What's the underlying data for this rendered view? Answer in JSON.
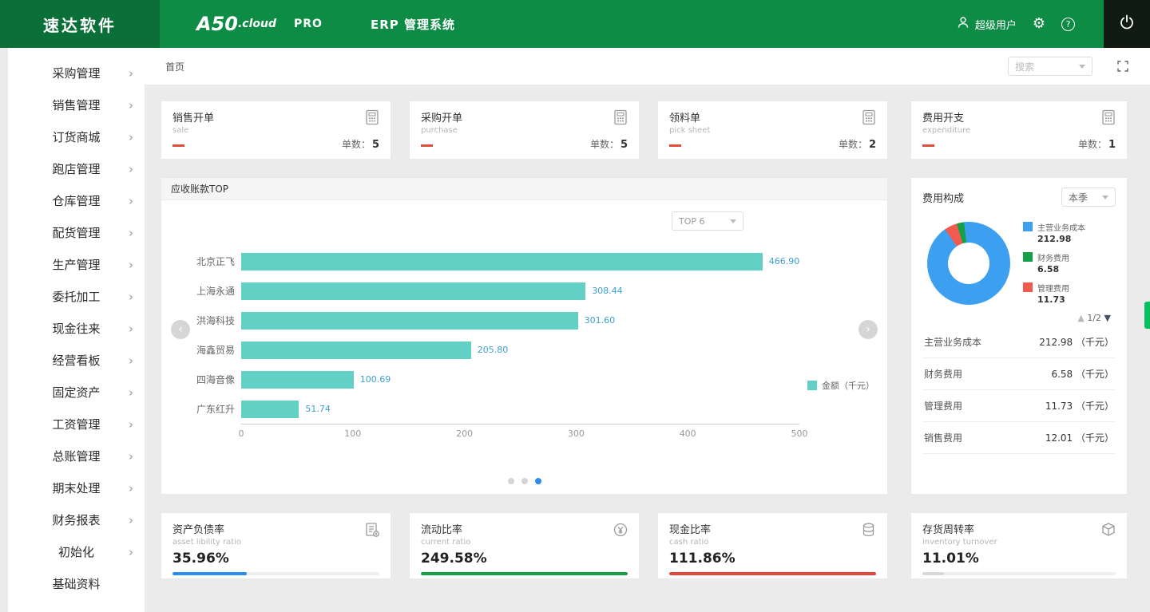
{
  "header": {
    "logo": "速达软件",
    "brand": "A50",
    "brand_suffix": ".cloud",
    "brand_pro": "PRO",
    "app_title": "ERP 管理系统",
    "user": "超级用户"
  },
  "icons": {
    "user": "user-icon",
    "settings": "gear-icon",
    "help": "help-icon",
    "power": "power-icon",
    "fullscreen": "fullscreen-icon",
    "calculator": "calculator-icon",
    "chevron": "chevron-right-icon"
  },
  "topbar": {
    "breadcrumb": "首页",
    "search_placeholder": "搜索"
  },
  "sidebar": {
    "items": [
      {
        "label": "采购管理",
        "chevron": true
      },
      {
        "label": "销售管理",
        "chevron": true
      },
      {
        "label": "订货商城",
        "chevron": true
      },
      {
        "label": "跑店管理",
        "chevron": true
      },
      {
        "label": "仓库管理",
        "chevron": true
      },
      {
        "label": "配货管理",
        "chevron": true
      },
      {
        "label": "生产管理",
        "chevron": true
      },
      {
        "label": "委托加工",
        "chevron": true
      },
      {
        "label": "现金往来",
        "chevron": true
      },
      {
        "label": "经营看板",
        "chevron": true
      },
      {
        "label": "固定资产",
        "chevron": true
      },
      {
        "label": "工资管理",
        "chevron": true
      },
      {
        "label": "总账管理",
        "chevron": true
      },
      {
        "label": "期末处理",
        "chevron": true
      },
      {
        "label": "财务报表",
        "chevron": true
      },
      {
        "label": "初始化",
        "chevron": true
      },
      {
        "label": "基础资料",
        "chevron": false
      }
    ]
  },
  "stat_cards": [
    {
      "title": "销售开单",
      "subtitle": "sale",
      "count_label": "单数：",
      "count": "5"
    },
    {
      "title": "采购开单",
      "subtitle": "purchase",
      "count_label": "单数：",
      "count": "5"
    },
    {
      "title": "领料单",
      "subtitle": "pick sheet",
      "count_label": "单数：",
      "count": "2"
    },
    {
      "title": "费用开支",
      "subtitle": "expenditure",
      "count_label": "单数：",
      "count": "1"
    }
  ],
  "chart_data": [
    {
      "type": "bar",
      "title": "应收账款TOP",
      "orientation": "horizontal",
      "top_filter": "TOP 6",
      "categories": [
        "北京正飞",
        "上海永通",
        "洪海科技",
        "海鑫贸易",
        "四海音像",
        "广东红升"
      ],
      "values": [
        466.9,
        308.44,
        301.6,
        205.8,
        100.69,
        51.74
      ],
      "xlim": [
        0,
        500
      ],
      "x_ticks": [
        "0",
        "100",
        "200",
        "300",
        "400",
        "500"
      ],
      "legend": "金额（千元）",
      "bar_color": "#62d0c5",
      "pagination": {
        "dots": 3,
        "active": 2
      }
    },
    {
      "type": "pie",
      "title": "费用构成",
      "period": "本季",
      "slices": [
        {
          "label": "主营业务成本",
          "value": 212.98,
          "color": "#3d9ff0"
        },
        {
          "label": "财务费用",
          "value": 6.58,
          "color": "#16a045"
        },
        {
          "label": "管理费用",
          "value": 11.73,
          "color": "#f05a50"
        }
      ],
      "pager": "1/2",
      "list": [
        {
          "label": "主营业务成本",
          "value": "212.98",
          "unit": "（千元）"
        },
        {
          "label": "财务费用",
          "value": "6.58",
          "unit": "（千元）"
        },
        {
          "label": "管理费用",
          "value": "11.73",
          "unit": "（千元）"
        },
        {
          "label": "销售费用",
          "value": "12.01",
          "unit": "（千元）"
        }
      ]
    }
  ],
  "ratio_cards": [
    {
      "title": "资产负债率",
      "subtitle": "asset libility ratio",
      "value": "35.96%",
      "percent": 36,
      "bar_color": "#2d8cf0"
    },
    {
      "title": "流动比率",
      "subtitle": "current ratio",
      "value": "249.58%",
      "percent": 100,
      "bar_color": "#16a045"
    },
    {
      "title": "现金比率",
      "subtitle": "cash ratio",
      "value": "111.86%",
      "percent": 100,
      "bar_color": "#e0443a"
    },
    {
      "title": "存货周转率",
      "subtitle": "inventory turnover",
      "value": "11.01%",
      "percent": 11,
      "bar_color": "#d9d9d9"
    }
  ],
  "colors": {
    "header_green": "#0e8c46",
    "logo_green": "#0b7038",
    "edge_tab_green": "#06c05f",
    "bar_teal": "#62d0c5",
    "dot_active": "#2d8cf0"
  }
}
